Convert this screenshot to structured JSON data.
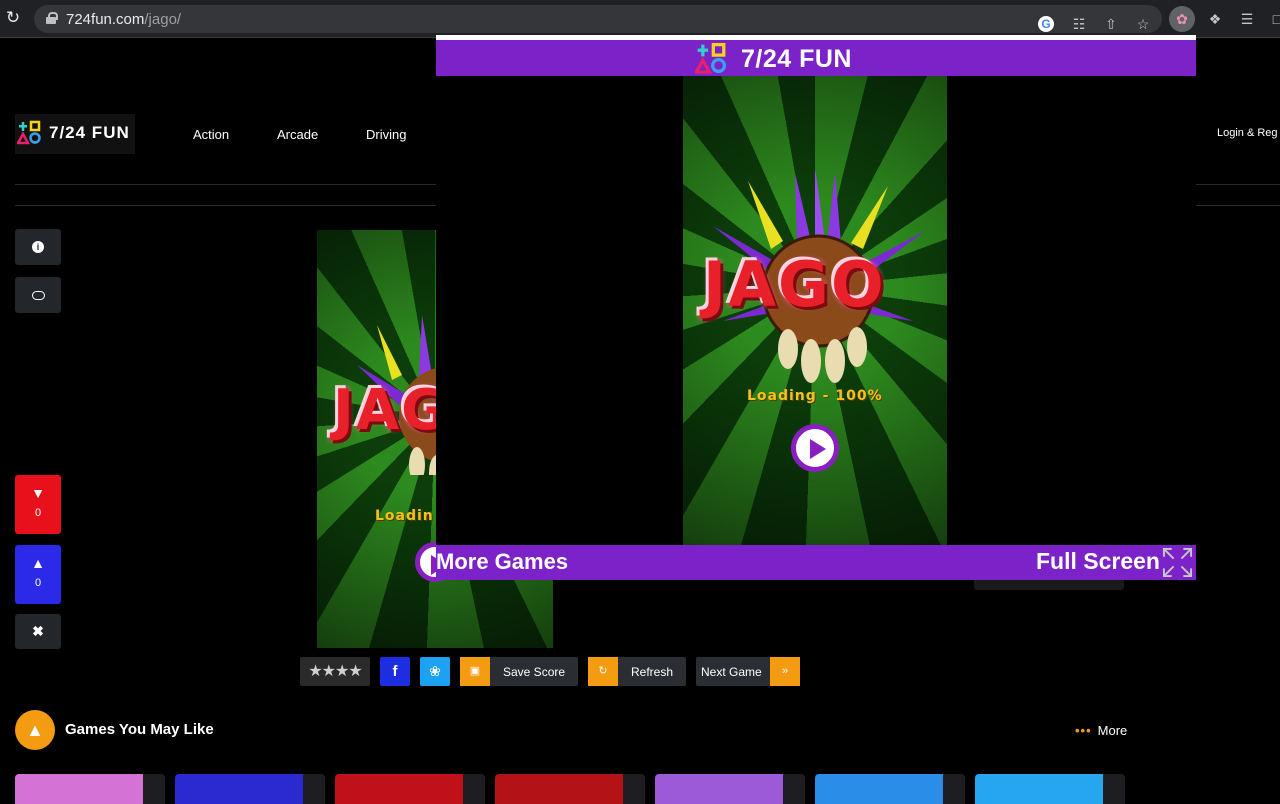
{
  "browser": {
    "url_domain": "724fun.com",
    "url_path": "/jago/"
  },
  "site": {
    "logo_text": "7/24 FUN",
    "nav": [
      "Action",
      "Arcade",
      "Driving"
    ],
    "login": "Login & Reg"
  },
  "votes": {
    "dislike_count": "0",
    "like_count": "0"
  },
  "game": {
    "title_art": "JAGO",
    "loading_text": "Loading - 100%",
    "loading_partial": "Loadin"
  },
  "toolbar": {
    "stars": "★★★★",
    "facebook": "f",
    "save_score": "Save Score",
    "refresh": "Refresh",
    "next_game": "Next Game",
    "next_arrow": "»"
  },
  "recommend": {
    "title": "Games You May Like",
    "more": "More",
    "more_dots": "•••",
    "thumbs": [
      {
        "color": "#d472d6"
      },
      {
        "color": "#2a2ad0"
      },
      {
        "color": "#c0101a"
      },
      {
        "color": "#b31217"
      },
      {
        "color": "#9c5ad8"
      },
      {
        "color": "#2a8ee8"
      },
      {
        "color": "#27a6f0"
      }
    ]
  },
  "overlay": {
    "header_title": "7/24 FUN",
    "more_games": "More Games",
    "full_screen": "Full Screen"
  },
  "icons": {
    "info": "info-icon",
    "chat": "chat-icon",
    "thumbs_down": "thumbs-down-icon",
    "thumbs_up": "thumbs-up-icon",
    "expand": "expand-icon"
  },
  "colors": {
    "purple": "#7b22c8",
    "orange": "#f39c12",
    "dislike": "#e8101a",
    "like": "#2a2ae8"
  }
}
